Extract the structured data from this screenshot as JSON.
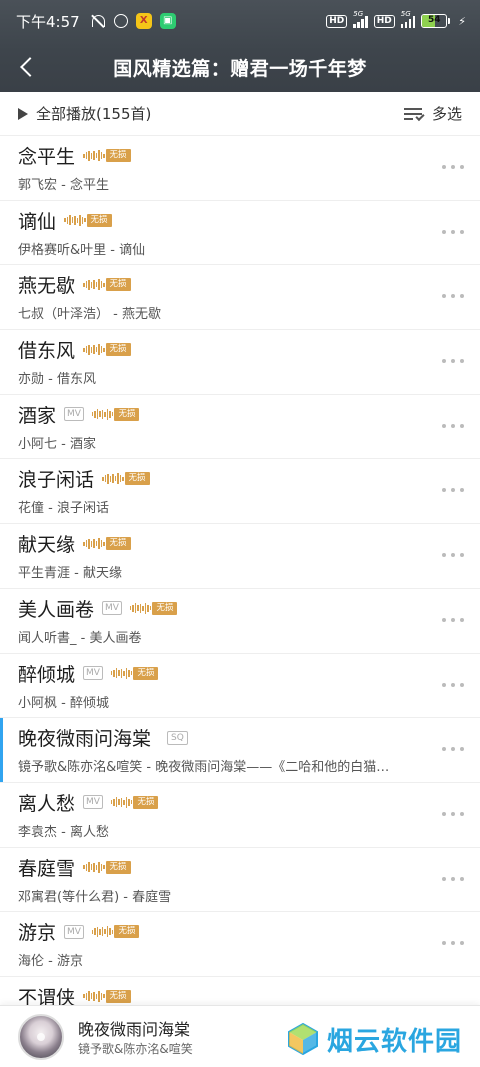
{
  "status": {
    "time": "下午4:57",
    "app_icon_1": "X",
    "app_icon_2": "▣",
    "hd1": "HD",
    "net1": "5G",
    "hd2": "HD",
    "net2": "5G",
    "battery": "54",
    "battery_level": 0.54
  },
  "nav": {
    "title": "国风精选篇：赠君一场千年梦"
  },
  "playall": {
    "label": "全部播放",
    "count": "(155首)",
    "multi_label": "多选"
  },
  "badges": {
    "lossless": "无损",
    "mv": "MV",
    "sq": "SQ"
  },
  "songs": [
    {
      "title": "念平生",
      "subtitle": "郭飞宏 - 念平生",
      "badges": [
        "lossless"
      ]
    },
    {
      "title": "谪仙",
      "subtitle": "伊格赛听&叶里 - 谪仙",
      "badges": [
        "lossless"
      ]
    },
    {
      "title": "燕无歇",
      "subtitle": "七叔（叶泽浩） - 燕无歇",
      "badges": [
        "lossless"
      ]
    },
    {
      "title": "借东风",
      "subtitle": "亦勋 - 借东风",
      "badges": [
        "lossless"
      ]
    },
    {
      "title": "酒家",
      "subtitle": "小阿七 - 酒家",
      "badges": [
        "mv",
        "lossless"
      ]
    },
    {
      "title": "浪子闲话",
      "subtitle": "花僮 - 浪子闲话",
      "badges": [
        "lossless"
      ]
    },
    {
      "title": "献天缘",
      "subtitle": "平生青涯 - 献天缘",
      "badges": [
        "lossless"
      ]
    },
    {
      "title": "美人画卷",
      "subtitle": "闻人听書_ - 美人画卷",
      "badges": [
        "mv",
        "lossless"
      ]
    },
    {
      "title": "醉倾城",
      "subtitle": "小阿枫 - 醉倾城",
      "badges": [
        "mv",
        "lossless"
      ]
    },
    {
      "title": "晚夜微雨问海棠",
      "subtitle": "镜予歌&陈亦洺&喧笑 - 晚夜微雨问海棠——《二哈和他的白猫…",
      "badges": [
        "sq"
      ],
      "current": true
    },
    {
      "title": "离人愁",
      "subtitle": "李袁杰 - 离人愁",
      "badges": [
        "mv",
        "lossless"
      ]
    },
    {
      "title": "春庭雪",
      "subtitle": "邓寓君(等什么君) - 春庭雪",
      "badges": [
        "lossless"
      ]
    },
    {
      "title": "游京",
      "subtitle": "海伦 - 游京",
      "badges": [
        "mv",
        "lossless"
      ]
    },
    {
      "title": "不谓侠",
      "subtitle": "",
      "badges": [
        "lossless"
      ]
    }
  ],
  "player": {
    "title": "晚夜微雨问海棠",
    "artist": "镜予歌&陈亦洺&喧笑"
  },
  "watermark": {
    "text": "烟云软件园"
  },
  "colors": {
    "header_bg": "#3e454c",
    "accent_gold": "#d9a04a",
    "current_indicator": "#31a4f0",
    "watermark": "#2aa6e0"
  }
}
